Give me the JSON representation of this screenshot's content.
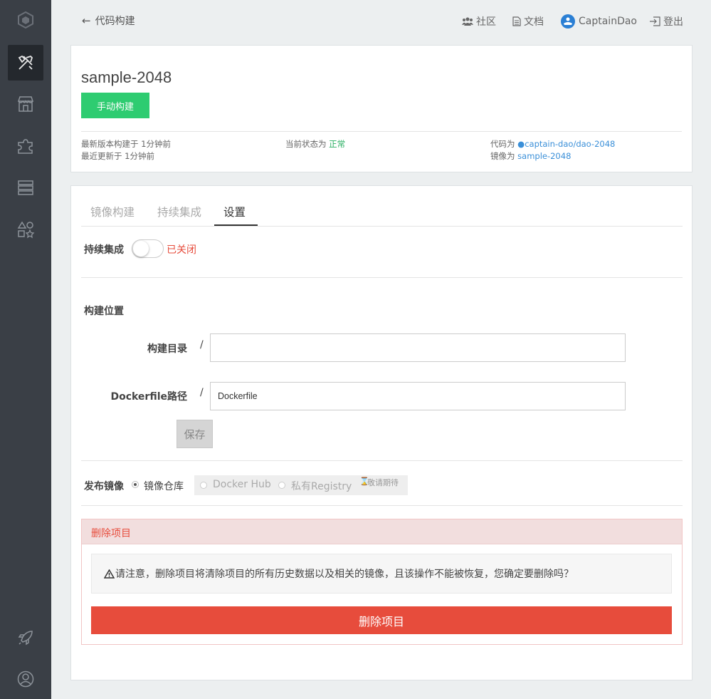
{
  "topbar": {
    "back_label": "代码构建",
    "community": "社区",
    "docs": "文档",
    "username": "CaptainDao",
    "logout": "登出"
  },
  "project": {
    "name": "sample-2048",
    "build_button": "手动构建",
    "latest_build": "最新版本构建于 1分钟前",
    "last_update": "最近更新于 1分钟前",
    "status_prefix": "当前状态为",
    "status": "正常",
    "code_prefix": "代码为",
    "code_repo": "captain-dao/dao-2048",
    "image_prefix": "镜像为",
    "image_name": "sample-2048"
  },
  "tabs": [
    "镜像构建",
    "持续集成",
    "设置"
  ],
  "settings": {
    "ci_label": "持续集成",
    "ci_state": "已关闭",
    "build_location_title": "构建位置",
    "build_dir_label": "构建目录",
    "build_dir_value": "",
    "dockerfile_label": "Dockerfile路径",
    "dockerfile_value": "Dockerfile",
    "slash": "/",
    "save_button": "保存",
    "publish_label": "发布镜像",
    "publish_options": [
      "镜像仓库",
      "Docker Hub",
      "私有Registry"
    ],
    "coming_soon": "敬请期待"
  },
  "danger": {
    "title": "删除项目",
    "warning": "请注意，删除项目将清除项目的所有历史数据以及相关的镜像，且该操作不能被恢复，您确定要删除吗？",
    "delete_button": "删除项目"
  },
  "colors": {
    "sidebar": "#3a3f46",
    "green": "#2ecc71",
    "danger": "#e74c3c",
    "link": "#3a8fd8"
  }
}
